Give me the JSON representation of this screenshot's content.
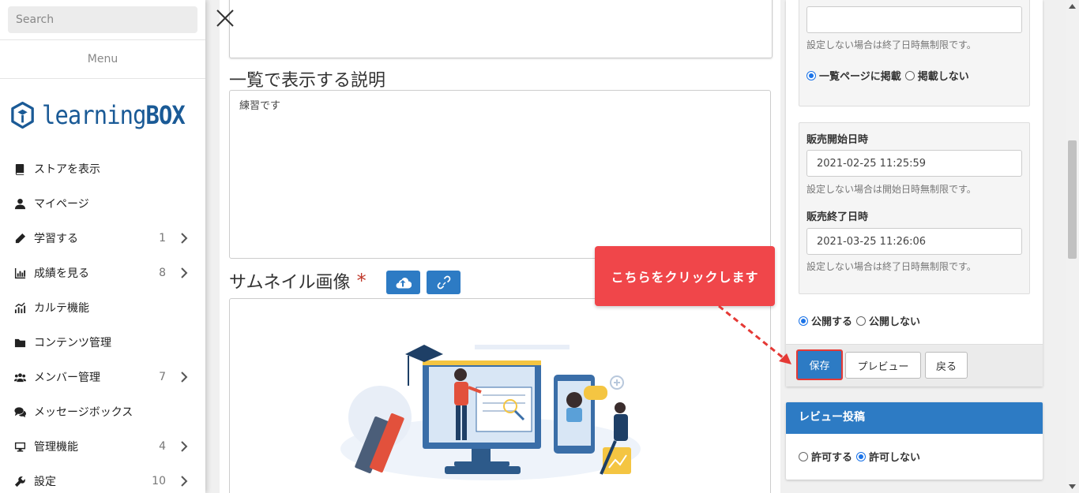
{
  "sidebar": {
    "search_placeholder": "Search",
    "menu_label": "Menu",
    "logo_text_light": "learning",
    "logo_text_bold": "BOX",
    "items": [
      {
        "label": "ストアを表示",
        "icon": "book-icon",
        "count": "",
        "chevron": false
      },
      {
        "label": "マイページ",
        "icon": "user-icon",
        "count": "",
        "chevron": false
      },
      {
        "label": "学習する",
        "icon": "pencil-icon",
        "count": "1",
        "chevron": true
      },
      {
        "label": "成績を見る",
        "icon": "bar-chart-icon",
        "count": "8",
        "chevron": true
      },
      {
        "label": "カルテ機能",
        "icon": "chart-line-icon",
        "count": "",
        "chevron": false
      },
      {
        "label": "コンテンツ管理",
        "icon": "folder-icon",
        "count": "",
        "chevron": false
      },
      {
        "label": "メンバー管理",
        "icon": "users-icon",
        "count": "7",
        "chevron": true
      },
      {
        "label": "メッセージボックス",
        "icon": "comments-icon",
        "count": "",
        "chevron": false
      },
      {
        "label": "管理機能",
        "icon": "monitor-icon",
        "count": "4",
        "chevron": true
      },
      {
        "label": "設定",
        "icon": "wrench-icon",
        "count": "10",
        "chevron": true
      }
    ]
  },
  "main": {
    "list_description_title": "一覧で表示する説明",
    "list_description_value": "練習です",
    "thumbnail_title": "サムネイル画像",
    "required_mark": "*"
  },
  "right": {
    "end_date_value": "",
    "end_date_help": "設定しない場合は終了日時無制限です。",
    "listing_options": [
      "一覧ページに掲載",
      "掲載しない"
    ],
    "sale_start_label": "販売開始日時",
    "sale_start_value": "2021-02-25 11:25:59",
    "sale_start_help": "設定しない場合は開始日時無制限です。",
    "sale_end_label": "販売終了日時",
    "sale_end_value": "2021-03-25 11:26:06",
    "sale_end_help": "設定しない場合は終了日時無制限です。",
    "publish_options": [
      "公開する",
      "公開しない"
    ],
    "save_label": "保存",
    "preview_label": "プレビュー",
    "back_label": "戻る"
  },
  "review": {
    "title": "レビュー投稿",
    "options": [
      "許可する",
      "許可しない"
    ]
  },
  "callout": {
    "text": "こちらをクリックします"
  },
  "colors": {
    "accent": "#2d7bc4",
    "callout": "#f0464a",
    "logo": "#1a5a96"
  }
}
